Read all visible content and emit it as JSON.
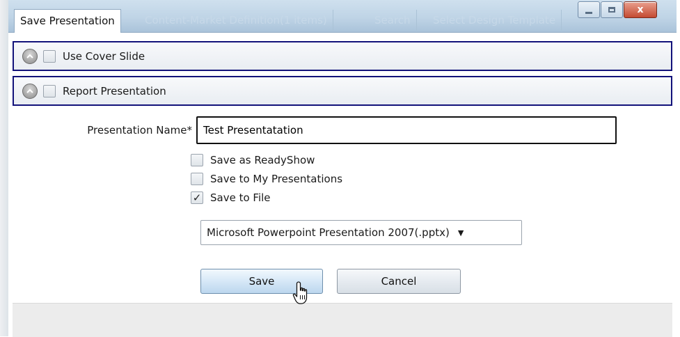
{
  "window": {
    "tabs": [
      {
        "label": "Save Presentation"
      },
      {
        "label": "Content-Market Definition(1 items)"
      },
      {
        "label": "Search"
      },
      {
        "label": "Select Design Template"
      }
    ],
    "close_glyph": "x",
    "minimize_icon": "minimize-icon",
    "maximize_icon": "maximize-icon"
  },
  "sections": [
    {
      "label": "Use Cover Slide",
      "checked": false
    },
    {
      "label": "Report Presentation",
      "checked": false
    }
  ],
  "form": {
    "name_label": "Presentation Name*",
    "name_value": "Test Presentatation",
    "options": [
      {
        "label": "Save as ReadyShow",
        "checked": false,
        "mark": ""
      },
      {
        "label": "Save to My Presentations",
        "checked": false,
        "mark": ""
      },
      {
        "label": "Save to File",
        "checked": true,
        "mark": "✓"
      }
    ],
    "format_selected": "Microsoft Powerpoint Presentation 2007(.pptx)",
    "dropdown_arrow": "▼"
  },
  "buttons": {
    "save": "Save",
    "cancel": "Cancel"
  },
  "colors": {
    "section_border": "#12127a",
    "titlebar": "#bfd4e6",
    "close_button": "#c44a32"
  }
}
